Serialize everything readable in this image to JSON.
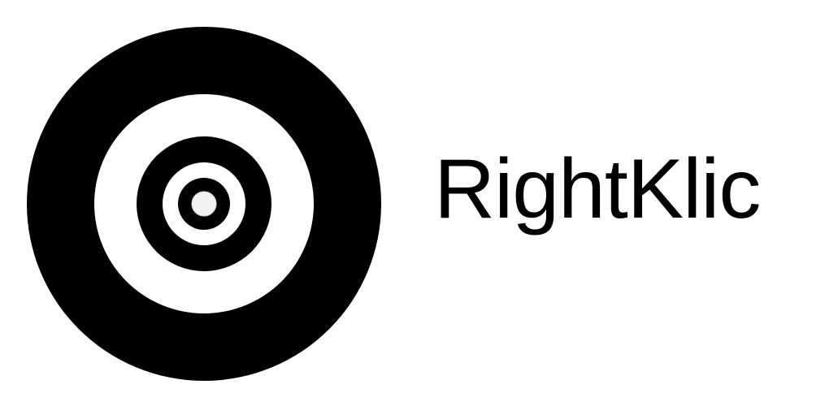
{
  "brand": {
    "name": "RightKlic",
    "icon": "concentric-rings-target-icon",
    "colors": {
      "foreground": "#000000",
      "background": "#ffffff",
      "center_dot": "#f2f2f2"
    }
  }
}
